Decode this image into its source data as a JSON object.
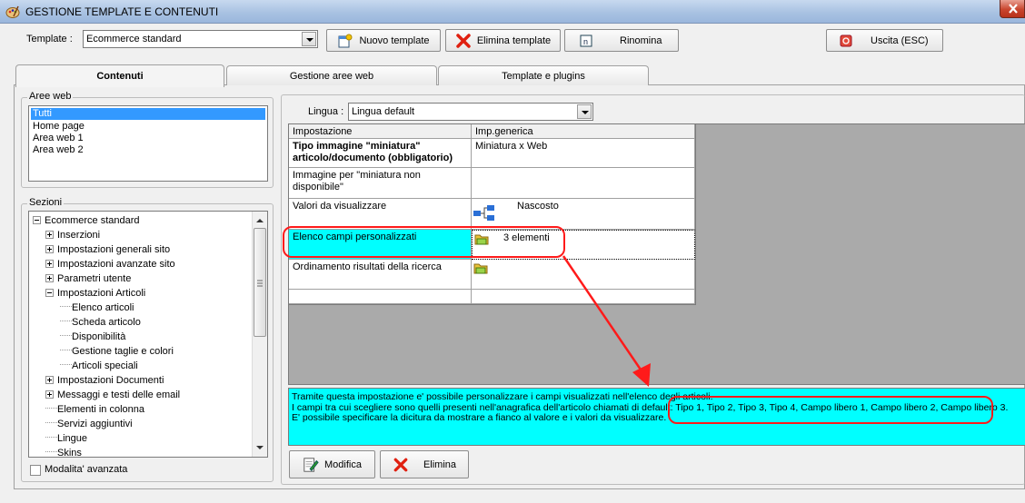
{
  "window": {
    "title": "GESTIONE TEMPLATE E CONTENUTI"
  },
  "toolbar": {
    "template_label": "Template :",
    "template_value": "Ecommerce standard",
    "new_template": "Nuovo template",
    "delete_template": "Elimina template",
    "rename": "Rinomina",
    "exit": "Uscita (ESC)"
  },
  "tabs": [
    {
      "label": "Contenuti",
      "active": true
    },
    {
      "label": "Gestione aree web",
      "active": false
    },
    {
      "label": "Template e plugins",
      "active": false
    }
  ],
  "aree_web": {
    "title": "Aree web",
    "items": [
      "Tutti",
      "Home page",
      "Area web 1",
      "Area web 2"
    ],
    "selected": "Tutti"
  },
  "sezioni": {
    "title": "Sezioni",
    "tree": [
      {
        "label": "Ecommerce standard",
        "level": 0,
        "expander": "minus"
      },
      {
        "label": "Inserzioni",
        "level": 1,
        "expander": "plus"
      },
      {
        "label": "Impostazioni generali sito",
        "level": 1,
        "expander": "plus"
      },
      {
        "label": "Impostazioni avanzate sito",
        "level": 1,
        "expander": "plus"
      },
      {
        "label": "Parametri utente",
        "level": 1,
        "expander": "plus"
      },
      {
        "label": "Impostazioni Articoli",
        "level": 1,
        "expander": "minus"
      },
      {
        "label": "Elenco articoli",
        "level": 2,
        "expander": ""
      },
      {
        "label": "Scheda articolo",
        "level": 2,
        "expander": ""
      },
      {
        "label": "Disponibilità",
        "level": 2,
        "expander": ""
      },
      {
        "label": "Gestione taglie e colori",
        "level": 2,
        "expander": ""
      },
      {
        "label": "Articoli speciali",
        "level": 2,
        "expander": ""
      },
      {
        "label": "Impostazioni Documenti",
        "level": 1,
        "expander": "plus"
      },
      {
        "label": "Messaggi e testi delle email",
        "level": 1,
        "expander": "plus"
      },
      {
        "label": "Elementi in colonna",
        "level": 1,
        "expander": ""
      },
      {
        "label": "Servizi aggiuntivi",
        "level": 1,
        "expander": ""
      },
      {
        "label": "Lingue",
        "level": 1,
        "expander": ""
      },
      {
        "label": "Skins",
        "level": 1,
        "expander": ""
      }
    ],
    "advanced_mode": "Modalita' avanzata"
  },
  "lingua": {
    "label": "Lingua :",
    "value": "Lingua default"
  },
  "grid": {
    "headers": [
      "Impostazione",
      "Imp.generica"
    ],
    "rows": [
      {
        "setting": "Tipo immagine \"miniatura\" articolo/documento (obbligatorio)",
        "value": "Miniatura x Web"
      },
      {
        "setting": "Immagine per \"miniatura non disponibile\"",
        "value": ""
      },
      {
        "setting": "Valori da visualizzare",
        "value": "Nascosto"
      },
      {
        "setting": "Elenco campi personalizzati",
        "value": "3 elementi"
      },
      {
        "setting": "Ordinamento risultati della ricerca",
        "value": ""
      },
      {
        "setting": "",
        "value": ""
      }
    ]
  },
  "description": {
    "line1": "Tramite questa impostazione e' possibile personalizzare i campi visualizzati nell'elenco degli articoli.",
    "line2": "I campi tra cui scegliere sono quelli presenti nell'anagrafica dell'articolo chiamati di default: Tipo 1, Tipo 2, Tipo 3, Tipo 4, Campo libero 1, Campo libero 2, Campo libero 3.",
    "line3": "E' possibile specificare la dicitura da mostrare a fianco al valore e i valori da visualizzare."
  },
  "actions": {
    "edit": "Modifica",
    "delete": "Elimina"
  },
  "colors": {
    "highlight": "#00ffff",
    "annotation": "#ff1a1a",
    "selection": "#3399ff"
  }
}
